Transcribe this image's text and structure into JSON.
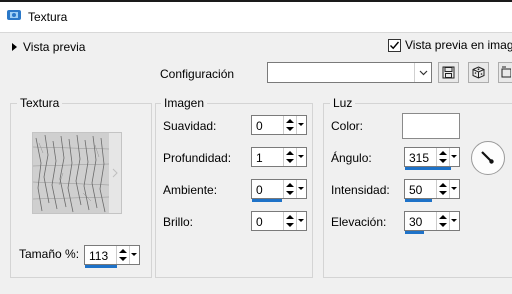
{
  "window": {
    "title": "Textura"
  },
  "preview": {
    "toggle_label": "Vista previa",
    "image_preview_label": "Vista previa en imagen",
    "image_preview_checked": true
  },
  "config": {
    "label": "Configuración",
    "value": ""
  },
  "texture": {
    "group_label": "Textura",
    "size_label": "Tamaño %:",
    "size_value": "113",
    "size_fraction": 0.6
  },
  "image": {
    "group_label": "Imagen",
    "fields": [
      {
        "label": "Suavidad:",
        "value": "0",
        "fraction": 0
      },
      {
        "label": "Profundidad:",
        "value": "1",
        "fraction": 0
      },
      {
        "label": "Ambiente:",
        "value": "0",
        "fraction": 0.55
      },
      {
        "label": "Brillo:",
        "value": "0",
        "fraction": 0
      }
    ]
  },
  "light": {
    "group_label": "Luz",
    "color_label": "Color:",
    "color_value": "#ffffff",
    "fields": [
      {
        "label": "Ángulo:",
        "value": "315",
        "fraction": 0.85
      },
      {
        "label": "Intensidad:",
        "value": "50",
        "fraction": 0.5
      },
      {
        "label": "Elevación:",
        "value": "30",
        "fraction": 0.35
      }
    ]
  },
  "colors": {
    "accent": "#1e72c8",
    "title_bar": "#ffffff",
    "dialog_bg": "#f0f0f0"
  }
}
